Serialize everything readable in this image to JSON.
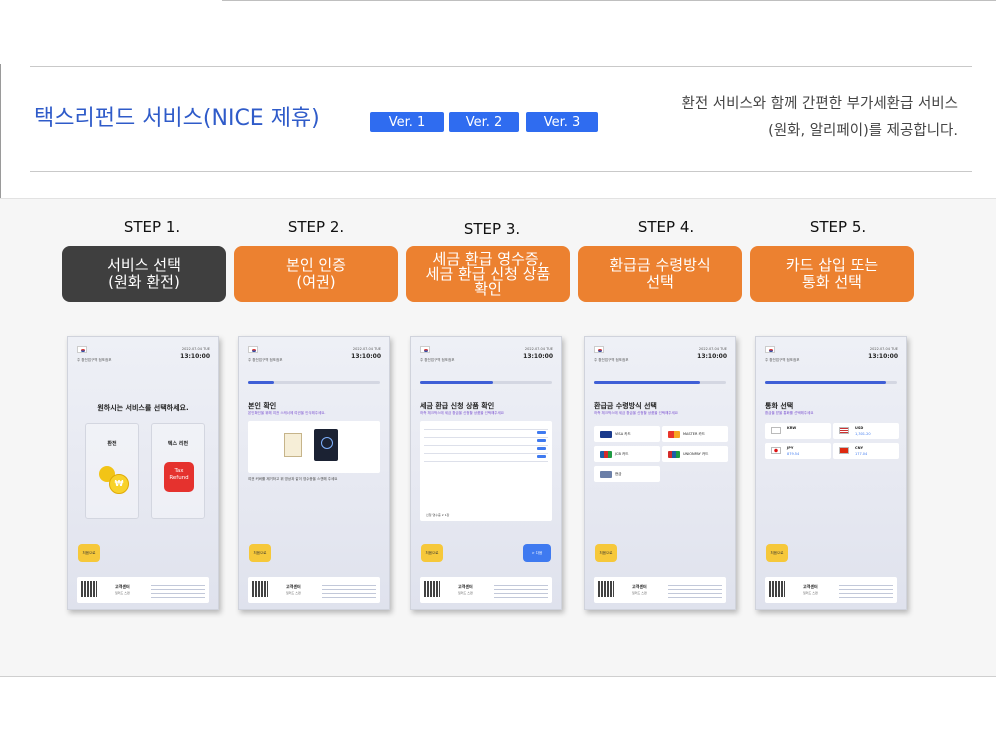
{
  "header": {
    "title": "택스리펀드 서비스(NICE 제휴)",
    "versions": [
      "Ver. 1",
      "Ver. 2",
      "Ver. 3"
    ],
    "description_line1": "환전 서비스와 함께 간편한 부가세환급 서비스",
    "description_line2": "(원화, 알리페이)를 제공합니다."
  },
  "steps": [
    {
      "label": "STEP 1.",
      "box": "서비스 선택\n(원화 환전)",
      "style": "dark"
    },
    {
      "label": "STEP 2.",
      "box": "본인 인증\n(여권)",
      "style": "orange"
    },
    {
      "label": "STEP 3.",
      "box": "세금 환급 영수증,\n세금 환급 신청 상품\n확인",
      "style": "orange"
    },
    {
      "label": "STEP 4.",
      "box": "환급금 수령방식\n선택",
      "style": "orange"
    },
    {
      "label": "STEP 5.",
      "box": "카드 삽입 또는\n통화 선택",
      "style": "orange"
    }
  ],
  "phones": {
    "common": {
      "shop": "주 환전업구역 점포점포",
      "date": "2022.07.04 TUE",
      "time": "13:10:00",
      "home": "처음으로",
      "center": "고객센터",
      "center_sub": "일러드 스편"
    },
    "s1": {
      "title": "원하시는 서비스를 선택하세요.",
      "card1": "환전",
      "card2": "텍스 리펀",
      "tax_badge": "Tax\nRefund"
    },
    "s2": {
      "heading": "본인 확인",
      "sub": "본인확인을 위해 여권 스캐너에 여권을 인식해주세요.",
      "note": "여권 커버를 제거하고 위 영상과 같이 영수증을 스캔해 주세요"
    },
    "s3": {
      "heading": "세금 환급 신청 상품 확인",
      "sub": "하측 체크박스에 세금 환급을 신청할 상품을 선택해주세요",
      "next": "> 다음",
      "total": "신청 영수증   2   1장"
    },
    "s4": {
      "heading": "환급금 수령방식 선택",
      "sub": "하측 체크박스에 세금 환급을 신청할 상품을 선택해주세요",
      "options": [
        "VISA 카드",
        "MASTER 카드",
        "JCB 카드",
        "UNIONPAY 카드",
        "현금"
      ]
    },
    "s5": {
      "heading": "통화 선택",
      "sub": "환급을 받을 통화를 선택해주세요",
      "currencies": [
        {
          "code": "KRW",
          "amount": ""
        },
        {
          "code": "USD",
          "amount": "1,301.20"
        },
        {
          "code": "JPY",
          "amount": "879.54"
        },
        {
          "code": "CNY",
          "amount": "177.04"
        }
      ]
    }
  },
  "colors": {
    "accent_blue": "#2f6cf0",
    "title_blue": "#2f5bc9",
    "step_dark": "#3f3f3f",
    "step_orange": "#ec8130"
  }
}
